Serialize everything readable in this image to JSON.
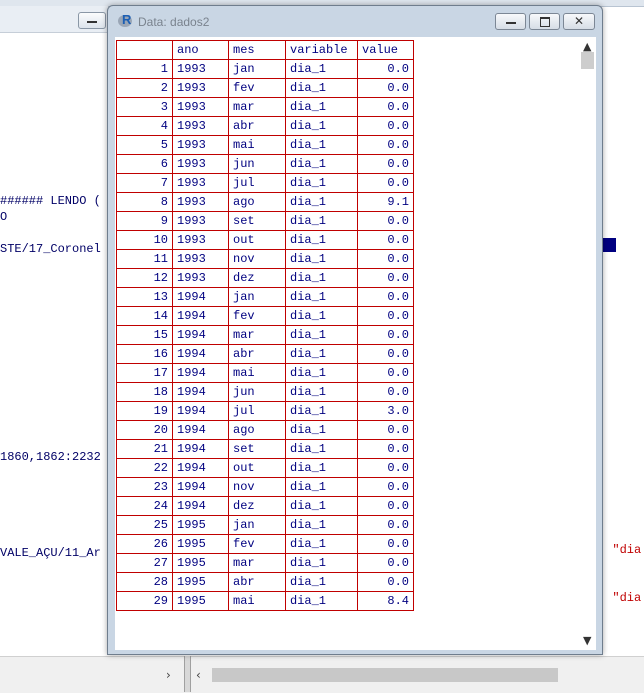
{
  "window": {
    "title": "Data: dados2",
    "app_icon": "R"
  },
  "table": {
    "columns": [
      "ano",
      "mes",
      "variable",
      "value"
    ],
    "rows": [
      {
        "n": "1",
        "ano": "1993",
        "mes": "jan",
        "variable": "dia_1",
        "value": "0.0"
      },
      {
        "n": "2",
        "ano": "1993",
        "mes": "fev",
        "variable": "dia_1",
        "value": "0.0"
      },
      {
        "n": "3",
        "ano": "1993",
        "mes": "mar",
        "variable": "dia_1",
        "value": "0.0"
      },
      {
        "n": "4",
        "ano": "1993",
        "mes": "abr",
        "variable": "dia_1",
        "value": "0.0"
      },
      {
        "n": "5",
        "ano": "1993",
        "mes": "mai",
        "variable": "dia_1",
        "value": "0.0"
      },
      {
        "n": "6",
        "ano": "1993",
        "mes": "jun",
        "variable": "dia_1",
        "value": "0.0"
      },
      {
        "n": "7",
        "ano": "1993",
        "mes": "jul",
        "variable": "dia_1",
        "value": "0.0"
      },
      {
        "n": "8",
        "ano": "1993",
        "mes": "ago",
        "variable": "dia_1",
        "value": "9.1"
      },
      {
        "n": "9",
        "ano": "1993",
        "mes": "set",
        "variable": "dia_1",
        "value": "0.0"
      },
      {
        "n": "10",
        "ano": "1993",
        "mes": "out",
        "variable": "dia_1",
        "value": "0.0"
      },
      {
        "n": "11",
        "ano": "1993",
        "mes": "nov",
        "variable": "dia_1",
        "value": "0.0"
      },
      {
        "n": "12",
        "ano": "1993",
        "mes": "dez",
        "variable": "dia_1",
        "value": "0.0"
      },
      {
        "n": "13",
        "ano": "1994",
        "mes": "jan",
        "variable": "dia_1",
        "value": "0.0"
      },
      {
        "n": "14",
        "ano": "1994",
        "mes": "fev",
        "variable": "dia_1",
        "value": "0.0"
      },
      {
        "n": "15",
        "ano": "1994",
        "mes": "mar",
        "variable": "dia_1",
        "value": "0.0"
      },
      {
        "n": "16",
        "ano": "1994",
        "mes": "abr",
        "variable": "dia_1",
        "value": "0.0"
      },
      {
        "n": "17",
        "ano": "1994",
        "mes": "mai",
        "variable": "dia_1",
        "value": "0.0"
      },
      {
        "n": "18",
        "ano": "1994",
        "mes": "jun",
        "variable": "dia_1",
        "value": "0.0"
      },
      {
        "n": "19",
        "ano": "1994",
        "mes": "jul",
        "variable": "dia_1",
        "value": "3.0"
      },
      {
        "n": "20",
        "ano": "1994",
        "mes": "ago",
        "variable": "dia_1",
        "value": "0.0"
      },
      {
        "n": "21",
        "ano": "1994",
        "mes": "set",
        "variable": "dia_1",
        "value": "0.0"
      },
      {
        "n": "22",
        "ano": "1994",
        "mes": "out",
        "variable": "dia_1",
        "value": "0.0"
      },
      {
        "n": "23",
        "ano": "1994",
        "mes": "nov",
        "variable": "dia_1",
        "value": "0.0"
      },
      {
        "n": "24",
        "ano": "1994",
        "mes": "dez",
        "variable": "dia_1",
        "value": "0.0"
      },
      {
        "n": "25",
        "ano": "1995",
        "mes": "jan",
        "variable": "dia_1",
        "value": "0.0"
      },
      {
        "n": "26",
        "ano": "1995",
        "mes": "fev",
        "variable": "dia_1",
        "value": "0.0"
      },
      {
        "n": "27",
        "ano": "1995",
        "mes": "mar",
        "variable": "dia_1",
        "value": "0.0"
      },
      {
        "n": "28",
        "ano": "1995",
        "mes": "abr",
        "variable": "dia_1",
        "value": "0.0"
      },
      {
        "n": "29",
        "ano": "1995",
        "mes": "mai",
        "variable": "dia_1",
        "value": "8.4"
      }
    ]
  },
  "console": {
    "lines": [
      "###### LENDO (",
      "O",
      "STE/17_Coronel",
      "1860,1862:2232",
      "VALE_AÇU/11_Ar"
    ],
    "red_fragments": [
      ", \"dia",
      ", \"dia"
    ]
  },
  "icons": {
    "minimize": "minimize-icon",
    "maximize": "maximize-icon",
    "close": "close-icon",
    "scroll_up": "scroll-up-icon",
    "scroll_down": "scroll-down-icon"
  }
}
